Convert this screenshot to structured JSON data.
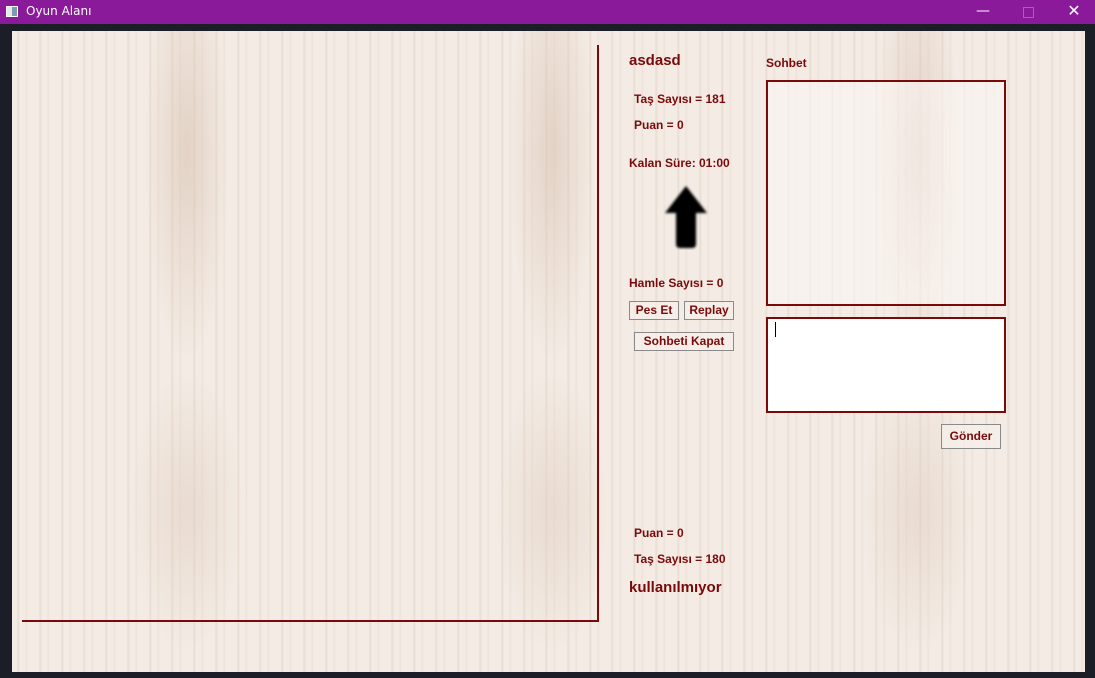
{
  "window": {
    "title": "Oyun Alanı",
    "minimize_glyph": "—",
    "close_glyph": "✕"
  },
  "opponent": {
    "name": "asdasd",
    "stones_label": "Taş Sayısı = 181",
    "score_label": "Puan = 0"
  },
  "timer": {
    "label": "Kalan Süre:",
    "value": "01:00"
  },
  "turn_indicator": {
    "icon": "arrow-up-icon",
    "direction": "up",
    "color": "#000000"
  },
  "moves_label": "Hamle Sayısı = 0",
  "buttons": {
    "resign": "Pes Et",
    "replay": "Replay",
    "close_chat": "Sohbeti Kapat",
    "send": "Gönder"
  },
  "chat": {
    "title": "Sohbet",
    "messages": [],
    "input_value": ""
  },
  "player": {
    "score_label": "Puan = 0",
    "stones_label": "Taş Sayısı = 180",
    "name": "kullanılmıyor"
  },
  "colors": {
    "titlebar": "#8a1a9a",
    "accent": "#7a0a0a",
    "wood": "#f3ebe4"
  }
}
